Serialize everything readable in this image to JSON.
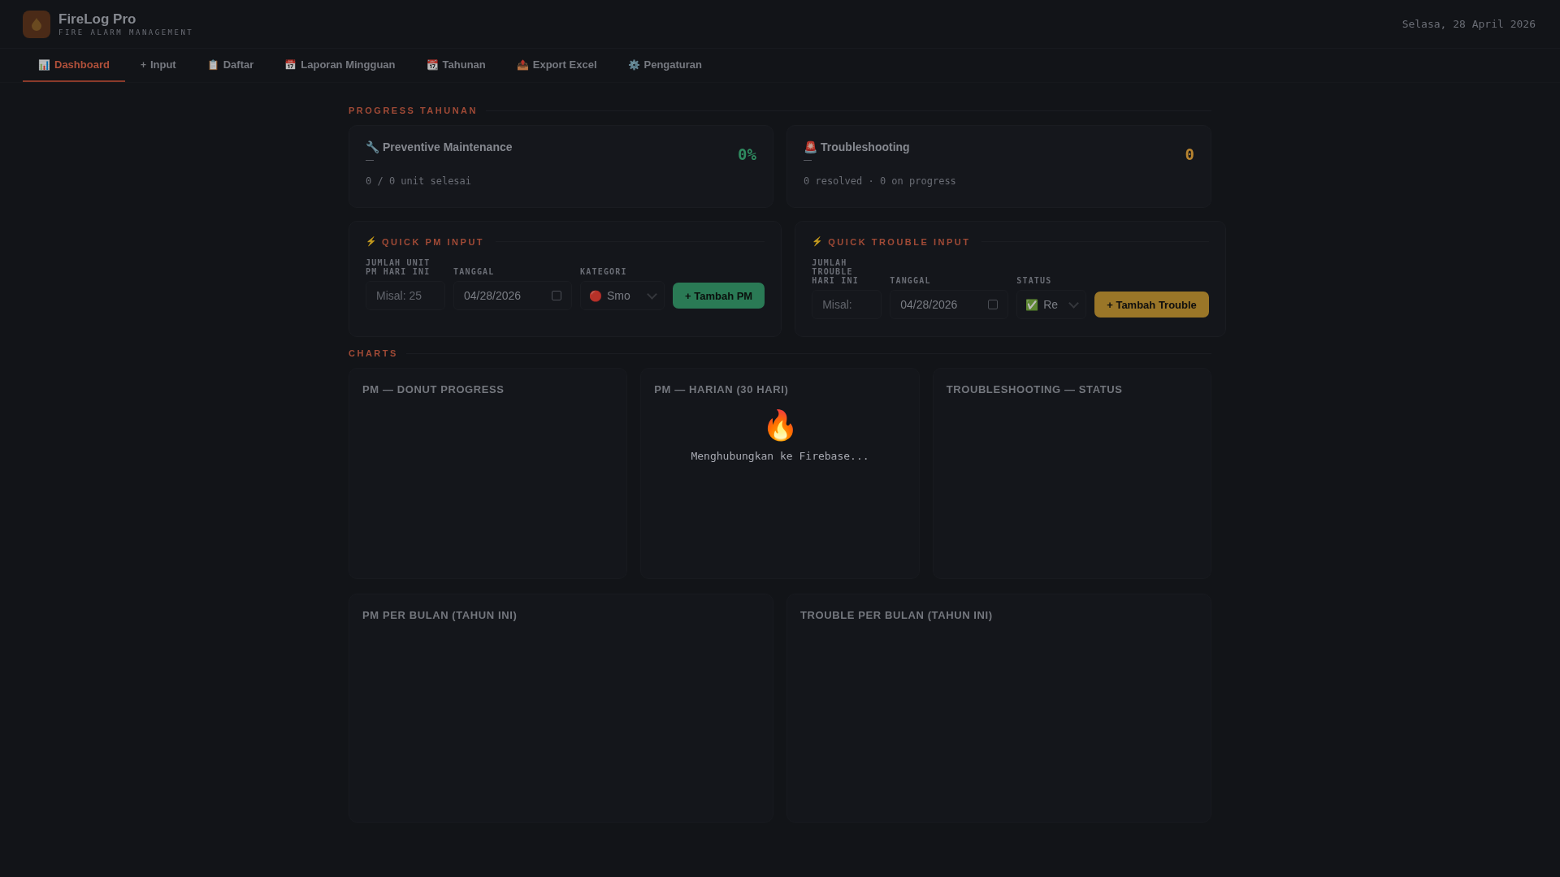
{
  "header": {
    "title": "FireLog Pro",
    "subtitle": "FIRE ALARM MANAGEMENT",
    "date": "Selasa, 28 April 2026"
  },
  "tabs": [
    {
      "icon": "📊",
      "label": "Dashboard",
      "selected": true
    },
    {
      "icon": "+",
      "label": "Input",
      "selected": false
    },
    {
      "icon": "📋",
      "label": "Daftar",
      "selected": false
    },
    {
      "icon": "📅",
      "label": "Laporan Mingguan",
      "selected": false
    },
    {
      "icon": "📆",
      "label": "Tahunan",
      "selected": false
    },
    {
      "icon": "📤",
      "label": "Export Excel",
      "selected": false
    },
    {
      "icon": "⚙️",
      "label": "Pengaturan",
      "selected": false
    }
  ],
  "progress": {
    "heading": "PROGRESS TAHUNAN",
    "cards": [
      {
        "kind": "pm",
        "icon": "🔧",
        "title": "Preventive Maintenance",
        "subtitle": "—",
        "value": "0%",
        "detail": "0 / 0 unit selesai"
      },
      {
        "kind": "trouble",
        "icon": "🚨",
        "title": "Troubleshooting",
        "subtitle": "—",
        "value": "0",
        "detail": "0 resolved · 0 on progress"
      }
    ]
  },
  "quick_inputs": [
    {
      "kind": "pm",
      "icon": "⚡",
      "heading": "QUICK PM INPUT",
      "fields": [
        {
          "kind": "number",
          "label": "JUMLAH UNIT PM HARI INI",
          "placeholder": "Misal: 25"
        },
        {
          "kind": "date",
          "label": "TANGGAL",
          "value": "04/28/2026"
        },
        {
          "kind": "select",
          "label": "KATEGORI",
          "icon": "🔴",
          "value": "Smo"
        }
      ],
      "button": "+ Tambah PM"
    },
    {
      "kind": "trouble",
      "icon": "⚡",
      "heading": "QUICK TROUBLE INPUT",
      "fields": [
        {
          "kind": "number",
          "label": "JUMLAH TROUBLE HARI INI",
          "placeholder": "Misal:"
        },
        {
          "kind": "date",
          "label": "TANGGAL",
          "value": "04/28/2026"
        },
        {
          "kind": "select",
          "label": "STATUS",
          "icon": "✅",
          "value": "Re"
        }
      ],
      "button": "+ Tambah Trouble"
    }
  ],
  "charts": {
    "heading": "CHARTS",
    "panels": [
      {
        "title": "PM — DONUT PROGRESS"
      },
      {
        "title": "PM — HARIAN (30 HARI)"
      },
      {
        "title": "TROUBLESHOOTING — STATUS"
      },
      {
        "title": "PM PER BULAN (TAHUN INI)"
      },
      {
        "title": "TROUBLE PER BULAN (TAHUN INI)"
      }
    ]
  },
  "loader": {
    "icon": "🔥",
    "text": "Menghubungkan ke Firebase..."
  }
}
